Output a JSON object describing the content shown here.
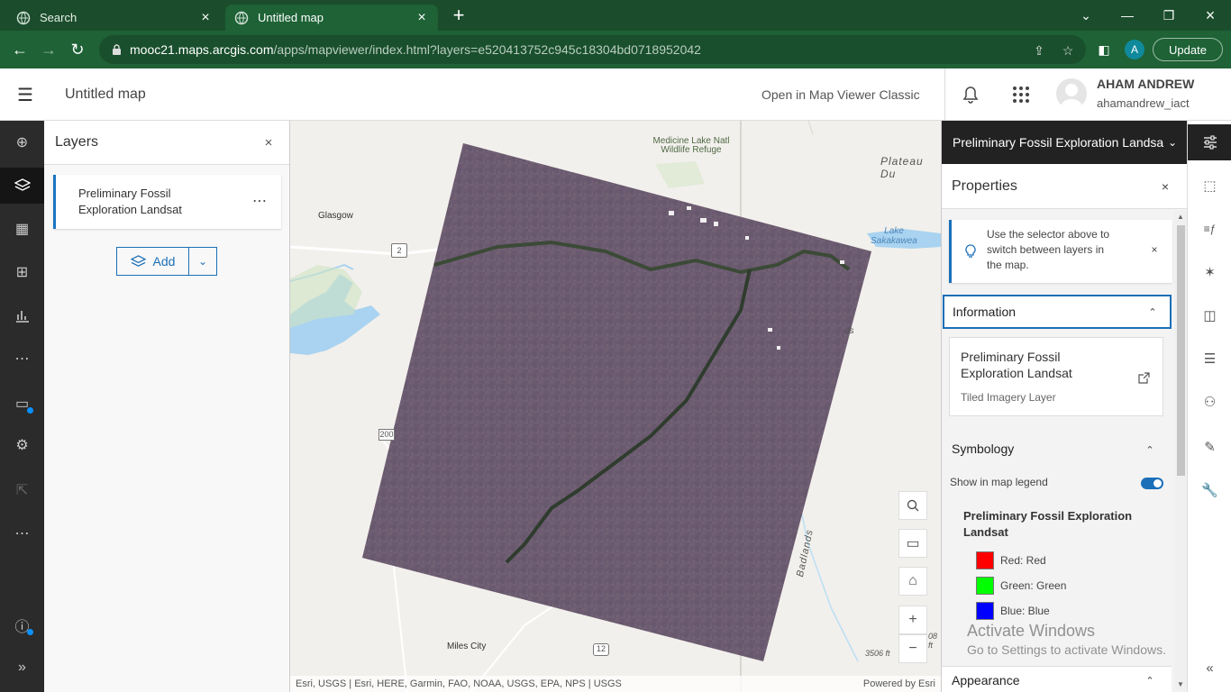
{
  "browser": {
    "tabs": [
      {
        "title": "Search",
        "active": false
      },
      {
        "title": "Untitled map",
        "active": true
      }
    ],
    "url_host": "mooc21.maps.arcgis.com",
    "url_path": "/apps/mapviewer/index.html?layers=e520413752c945c18304bd0718952042",
    "profile_initial": "A",
    "update_label": "Update"
  },
  "app": {
    "map_title": "Untitled map",
    "open_classic": "Open in Map Viewer Classic",
    "user_name": "AHAM ANDREW",
    "user_handle": "ahamandrew_iact"
  },
  "layers_panel": {
    "title": "Layers",
    "layer_name": "Preliminary Fossil Exploration Landsat",
    "add_label": "Add"
  },
  "map": {
    "labels": {
      "medicine_lake": "Medicine Lake Natl Wildlife Refuge",
      "plateau": "Plateau Du",
      "glasgow": "Glasgow",
      "lake_sakakawea": "Lake Sakakawea",
      "route2": "2",
      "route200": "200",
      "route12": "12",
      "miles_city": "Miles City",
      "badlands": "Badlands",
      "elev": "3506 ft",
      "ds": "ds",
      "ft": "08 ft"
    },
    "attribution": "Esri, USGS | Esri, HERE, Garmin, FAO, NOAA, USGS, EPA, NPS | USGS",
    "powered_by": "Powered by Esri"
  },
  "properties": {
    "selector_label": "Preliminary Fossil Exploration Landsa",
    "title": "Properties",
    "notice": "Use the selector above to switch between layers in the map.",
    "information": {
      "header": "Information",
      "name": "Preliminary Fossil Exploration Landsat",
      "type": "Tiled Imagery Layer"
    },
    "symbology": {
      "header": "Symbology",
      "show_legend": "Show in map legend",
      "legend_on": true,
      "name": "Preliminary Fossil Exploration Landsat",
      "bands": [
        {
          "label": "Red: Red",
          "color": "#ff0000"
        },
        {
          "label": "Green: Green",
          "color": "#00ff00"
        },
        {
          "label": "Blue: Blue",
          "color": "#0000ff"
        }
      ]
    },
    "appearance": {
      "header": "Appearance"
    }
  },
  "watermark": {
    "line1": "Activate Windows",
    "line2": "Go to Settings to activate Windows."
  },
  "colors": {
    "accent": "#1b6fb8",
    "browser_frame": "#1e6236",
    "toolbar_dark": "#2b2b2b"
  }
}
